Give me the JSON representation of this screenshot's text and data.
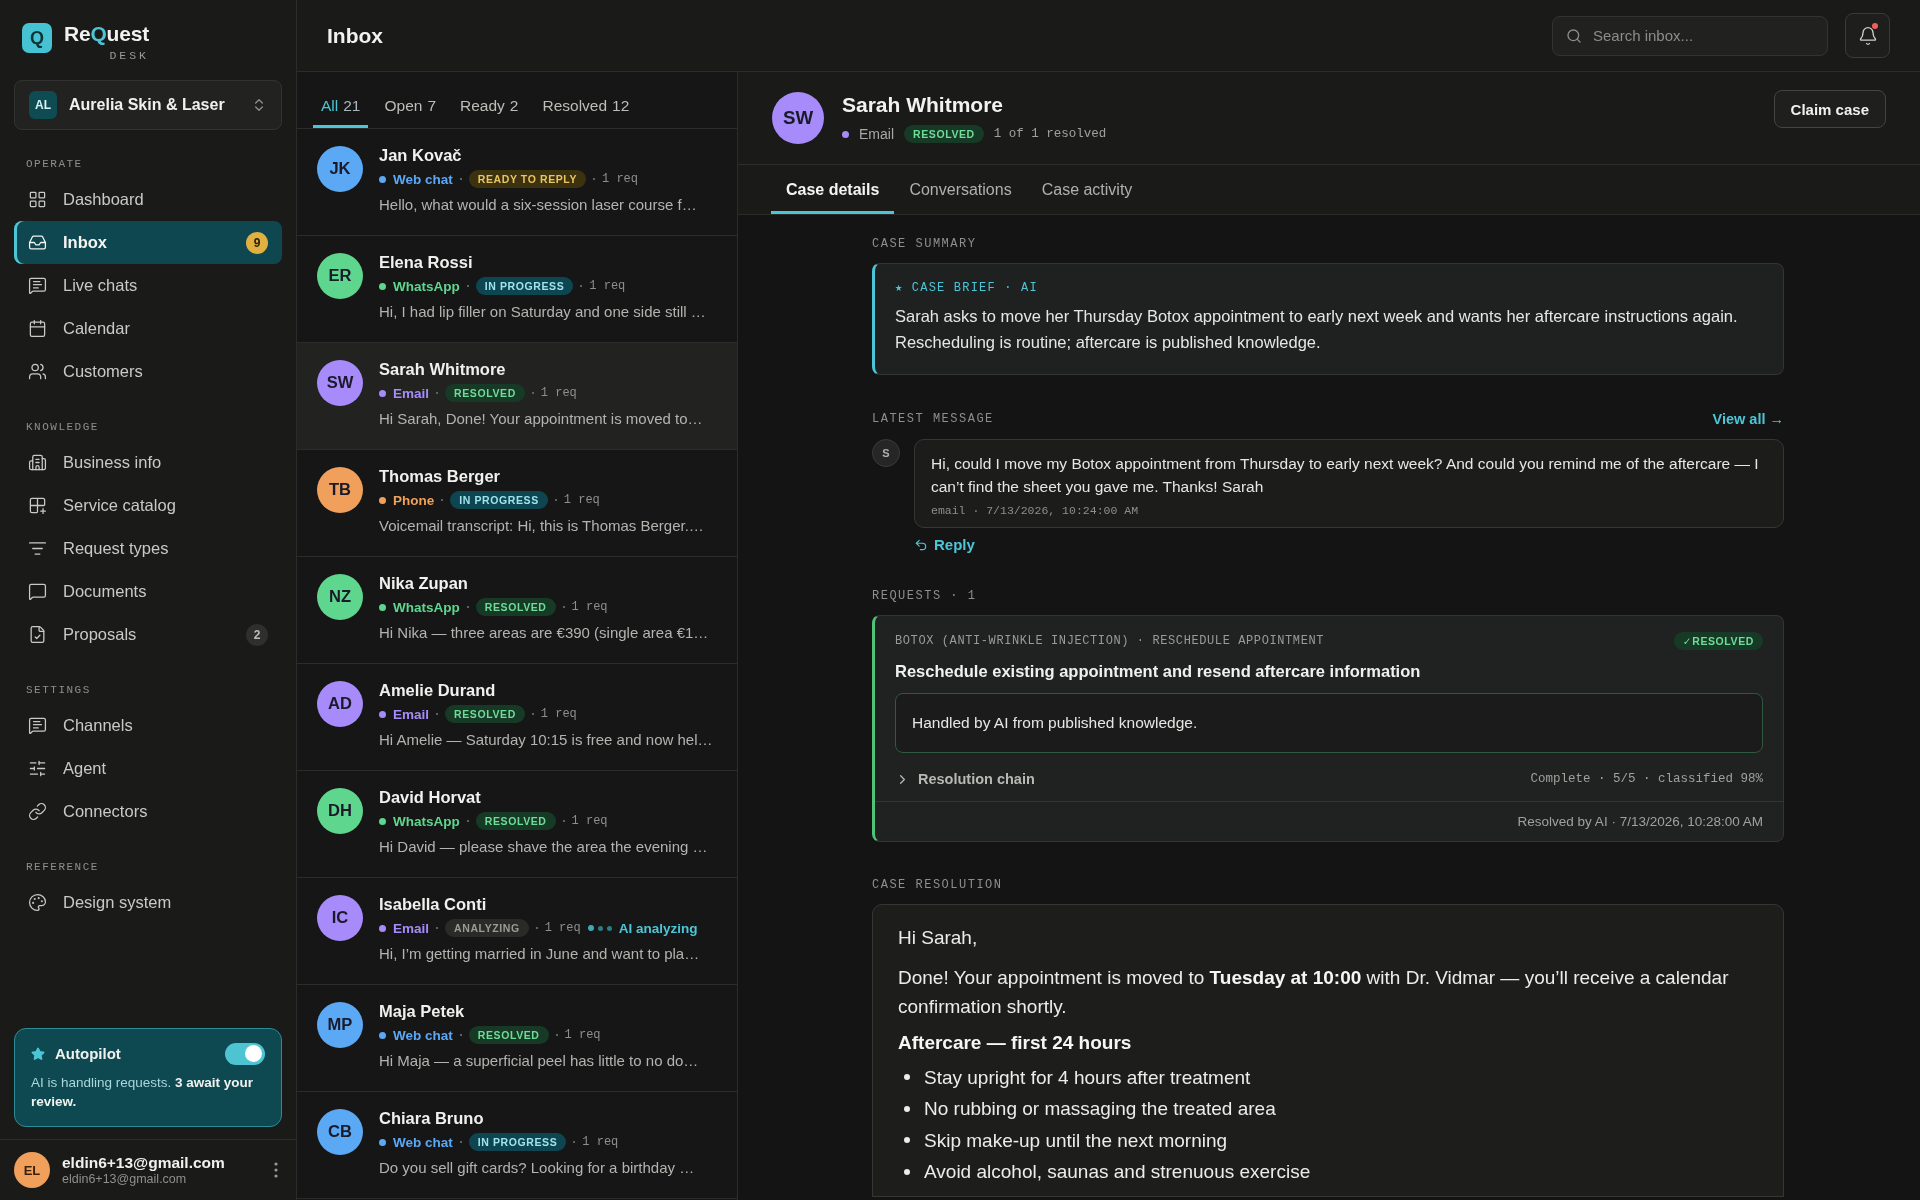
{
  "brand": {
    "logo": "Q",
    "name_parts": [
      {
        "text": "Re",
        "accent": false
      },
      {
        "text": "Q",
        "accent": true
      },
      {
        "text": "uest",
        "accent": false
      }
    ],
    "subtitle": "DESK"
  },
  "workspace": {
    "initials": "AL",
    "name": "Aurelia Skin & Laser"
  },
  "nav_sections": [
    {
      "title": "OPERATE",
      "items": [
        {
          "label": "Dashboard",
          "selected": false
        },
        {
          "label": "Inbox",
          "selected": true,
          "badge": {
            "text": "9",
            "kind": "alert"
          }
        },
        {
          "label": "Live chats",
          "selected": false
        },
        {
          "label": "Calendar",
          "selected": false
        },
        {
          "label": "Customers",
          "selected": false
        }
      ]
    },
    {
      "title": "KNOWLEDGE",
      "items": [
        {
          "label": "Business info",
          "selected": false
        },
        {
          "label": "Service catalog",
          "selected": false
        },
        {
          "label": "Request types",
          "selected": false
        },
        {
          "label": "Documents",
          "selected": false
        },
        {
          "label": "Proposals",
          "selected": false,
          "badge": {
            "text": "2",
            "kind": "count"
          }
        }
      ]
    },
    {
      "title": "SETTINGS",
      "items": [
        {
          "label": "Channels",
          "selected": false
        },
        {
          "label": "Agent",
          "selected": false
        },
        {
          "label": "Connectors",
          "selected": false
        }
      ]
    },
    {
      "title": "REFERENCE",
      "items": [
        {
          "label": "Design system",
          "selected": false
        }
      ]
    }
  ],
  "autopilot": {
    "title": "Autopilot",
    "on": true,
    "text": "AI is handling requests. **3 await your review.**"
  },
  "user": {
    "initials": "EL",
    "name": "eldin6+13@gmail.com",
    "email": "eldin6+13@gmail.com"
  },
  "header": {
    "title": "Inbox",
    "search": {
      "placeholder": "Search inbox..."
    },
    "notifications": {
      "unread": true
    }
  },
  "filters": [
    {
      "label": "All",
      "count": "21",
      "selected": true
    },
    {
      "label": "Open",
      "count": "7",
      "selected": false
    },
    {
      "label": "Ready",
      "count": "2",
      "selected": false
    },
    {
      "label": "Resolved",
      "count": "12",
      "selected": false
    }
  ],
  "conversations": [
    {
      "initials": "JK",
      "name": "Jan Kovač",
      "color": "#5ba8f5",
      "channel": "Web chat",
      "status": {
        "text": "READY TO REPLY",
        "kind": "ready"
      },
      "requests": "1 req",
      "preview": "Hello, what would a six-session laser course f…",
      "selected": false
    },
    {
      "initials": "ER",
      "name": "Elena Rossi",
      "color": "#5fd68e",
      "channel": "WhatsApp",
      "status": {
        "text": "IN PROGRESS",
        "kind": "progress"
      },
      "requests": "1 req",
      "preview": "Hi, I had lip filler on Saturday and one side still …",
      "selected": false
    },
    {
      "initials": "SW",
      "name": "Sarah Whitmore",
      "color": "#a78bfa",
      "channel": "Email",
      "status": {
        "text": "RESOLVED",
        "kind": "resolved"
      },
      "requests": "1 req",
      "preview": "Hi Sarah, Done! Your appointment is moved to…",
      "selected": true
    },
    {
      "initials": "TB",
      "name": "Thomas Berger",
      "color": "#f0a05a",
      "channel": "Phone",
      "status": {
        "text": "IN PROGRESS",
        "kind": "progress"
      },
      "requests": "1 req",
      "preview": "Voicemail transcript: Hi, this is Thomas Berger.…",
      "selected": false
    },
    {
      "initials": "NZ",
      "name": "Nika Zupan",
      "color": "#5fd68e",
      "channel": "WhatsApp",
      "status": {
        "text": "RESOLVED",
        "kind": "resolved"
      },
      "requests": "1 req",
      "preview": "Hi Nika — three areas are €390 (single area €1…",
      "selected": false
    },
    {
      "initials": "AD",
      "name": "Amelie Durand",
      "color": "#a78bfa",
      "channel": "Email",
      "status": {
        "text": "RESOLVED",
        "kind": "resolved"
      },
      "requests": "1 req",
      "preview": "Hi Amelie — Saturday 10:15 is free and now hel…",
      "selected": false
    },
    {
      "initials": "DH",
      "name": "David Horvat",
      "color": "#5fd68e",
      "channel": "WhatsApp",
      "status": {
        "text": "RESOLVED",
        "kind": "resolved"
      },
      "requests": "1 req",
      "preview": "Hi David — please shave the area the evening …",
      "selected": false
    },
    {
      "initials": "IC",
      "name": "Isabella Conti",
      "color": "#a78bfa",
      "channel": "Email",
      "status": {
        "text": "ANALYZING",
        "kind": "analyzing"
      },
      "requests": "1 req",
      "ai_note": "AI analyzing",
      "preview": "Hi, I’m getting married in June and want to pla…",
      "selected": false
    },
    {
      "initials": "MP",
      "name": "Maja Petek",
      "color": "#5ba8f5",
      "channel": "Web chat",
      "status": {
        "text": "RESOLVED",
        "kind": "resolved"
      },
      "requests": "1 req",
      "preview": "Hi Maja — a superficial peel has little to no do…",
      "selected": false
    },
    {
      "initials": "CB",
      "name": "Chiara Bruno",
      "color": "#5ba8f5",
      "channel": "Web chat",
      "status": {
        "text": "IN PROGRESS",
        "kind": "progress"
      },
      "requests": "1 req",
      "preview": "Do you sell gift cards? Looking for a birthday …",
      "selected": false
    }
  ],
  "case": {
    "initials": "SW",
    "name": "Sarah Whitmore",
    "color": "#a78bfa",
    "channel": "Email",
    "status": {
      "text": "RESOLVED",
      "kind": "resolved"
    },
    "progress": "1 of 1 resolved",
    "action": "Claim case"
  },
  "case_tabs": [
    {
      "label": "Case details",
      "selected": true
    },
    {
      "label": "Conversations",
      "selected": false
    },
    {
      "label": "Case activity",
      "selected": false
    }
  ],
  "summary": {
    "heading": "CASE SUMMARY",
    "label": "★ CASE BRIEF · AI",
    "text": "Sarah asks to move her Thursday Botox appointment to early next week and wants her aftercare instructions again. Rescheduling is routine; aftercare is published knowledge."
  },
  "latest": {
    "heading": "LATEST MESSAGE",
    "link": "View all →",
    "sender": "S",
    "text": "Hi, could I move my Botox appointment from Thursday to early next week? And could you remind me of the aftercare — I can’t find the sheet you gave me. Thanks! Sarah",
    "meta": "email · 7/13/2026, 10:24:00 AM",
    "reply": "Reply"
  },
  "requests": {
    "heading": "REQUESTS · 1",
    "items": [
      {
        "category": "BOTOX (ANTI-WRINKLE INJECTION) · RESCHEDULE APPOINTMENT",
        "status": {
          "text": "✓RESOLVED",
          "kind": "resolved"
        },
        "title": "Reschedule existing appointment and resend aftercare information",
        "note": "Handled by AI from published knowledge.",
        "chain": "Resolution chain",
        "chain_expanded": false,
        "chain_meta": "Complete · 5/5 · classified 98%",
        "footer": "Resolved by AI · 7/13/2026, 10:28:00 AM"
      }
    ]
  },
  "resolution": {
    "heading": "CASE RESOLUTION",
    "greeting": "Hi Sarah,",
    "paragraph": "Done! Your appointment is moved to **Tuesday at 10:00** with Dr. Vidmar — you’ll receive a calendar confirmation shortly.",
    "subheading": "Aftercare — first 24 hours",
    "bullets": [
      "Stay upright for 4 hours after treatment",
      "No rubbing or massaging the treated area",
      "Skip make-up until the next morning",
      "Avoid alcohol, saunas and strenuous exercise"
    ]
  }
}
